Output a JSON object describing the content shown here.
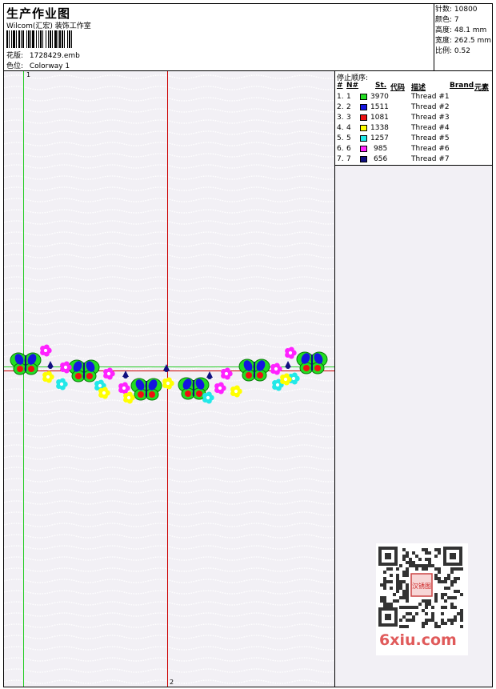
{
  "header": {
    "title": "生产作业图",
    "company": "Wilcom(汇宏) 装饰工作室",
    "design_label": "花版:",
    "design_value": "1728429.emb",
    "colorway_label": "色位:",
    "colorway_value": "Colorway 1"
  },
  "stats": {
    "stitches": "针数: 10800",
    "colors": "颜色: 7",
    "height": "高度: 48.1 mm",
    "width": "宽度: 262.5 mm",
    "scale": "比例: 0.52"
  },
  "stop_sequence": {
    "title": "停止顺序:",
    "headers": {
      "num": "#",
      "n": "N#",
      "st": "St.",
      "code": "代码",
      "desc": "描述",
      "brand": "Brand",
      "element": "元素"
    },
    "rows": [
      {
        "num": "1.",
        "n": "1",
        "st": "3970",
        "color": "#22dd22",
        "desc": "Thread #1"
      },
      {
        "num": "2.",
        "n": "2",
        "st": "1511",
        "color": "#1515e0",
        "desc": "Thread #2"
      },
      {
        "num": "3.",
        "n": "3",
        "st": "1081",
        "color": "#ee1111",
        "desc": "Thread #3"
      },
      {
        "num": "4.",
        "n": "4",
        "st": "1338",
        "color": "#ffff00",
        "desc": "Thread #4"
      },
      {
        "num": "5.",
        "n": "5",
        "st": "1257",
        "color": "#22e8e8",
        "desc": "Thread #5"
      },
      {
        "num": "6.",
        "n": "6",
        "st": "985",
        "color": "#ff22ff",
        "desc": "Thread #6"
      },
      {
        "num": "7.",
        "n": "7",
        "st": "656",
        "color": "#101080",
        "desc": "Thread #7"
      }
    ]
  },
  "guides": {
    "marker_1": "1",
    "marker_2": "2",
    "v_color": "#cc0000",
    "h_color": "#cc0000",
    "origin_color": "#22cc22"
  },
  "watermark": {
    "site": "6xiu.com",
    "stamp": "汉锈图"
  }
}
